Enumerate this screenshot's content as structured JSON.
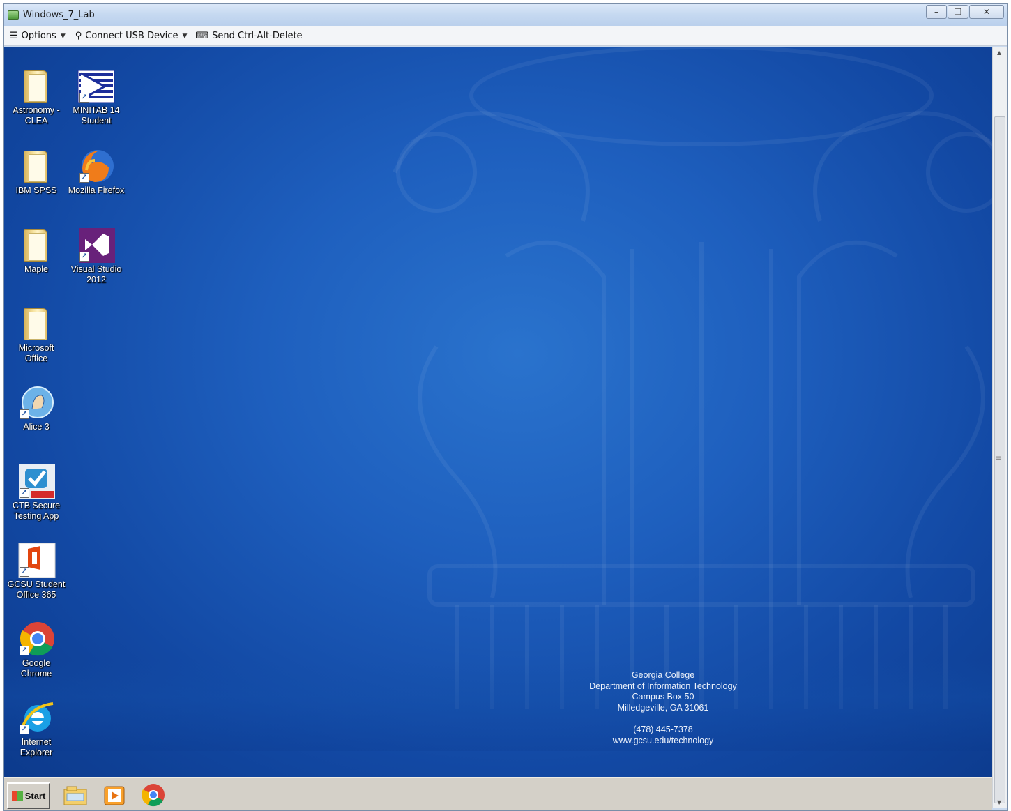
{
  "window": {
    "title": "Windows_7_Lab",
    "buttons": [
      "–",
      "❐",
      "✕"
    ]
  },
  "toolbar": {
    "options_label": "Options",
    "usb_label": "Connect USB Device",
    "cad_label": "Send Ctrl-Alt-Delete"
  },
  "desktop": {
    "icons": [
      {
        "label": "Astronomy -\nCLEA",
        "icon": "folder-icon"
      },
      {
        "label": "MINITAB 14\nStudent",
        "icon": "minitab-icon"
      },
      {
        "label": "IBM SPSS",
        "icon": "folder-icon"
      },
      {
        "label": "Mozilla Firefox",
        "icon": "firefox-icon"
      },
      {
        "label": "Maple",
        "icon": "folder-icon"
      },
      {
        "label": "Visual Studio\n2012",
        "icon": "visual-studio-icon"
      },
      {
        "label": "Microsoft\nOffice",
        "icon": "folder-icon"
      },
      {
        "label": "Alice 3",
        "icon": "alice-icon"
      },
      {
        "label": "CTB Secure\nTesting App",
        "icon": "ctb-icon"
      },
      {
        "label": "GCSU Student\nOffice 365",
        "icon": "office365-icon"
      },
      {
        "label": "Google\nChrome",
        "icon": "chrome-icon"
      },
      {
        "label": "Internet\nExplorer",
        "icon": "ie-icon"
      }
    ],
    "info": {
      "line1": "Georgia College",
      "line2": "Department of Information Technology",
      "line3": "Campus Box 50",
      "line4": "Milledgeville, GA 31061",
      "phone": "(478) 445-7378",
      "url": "www.gcsu.edu/technology"
    },
    "background_color": "#1e5fbe"
  },
  "taskbar": {
    "start_label": "Start",
    "items": [
      "file-explorer-icon",
      "media-player-icon",
      "chrome-icon"
    ]
  }
}
